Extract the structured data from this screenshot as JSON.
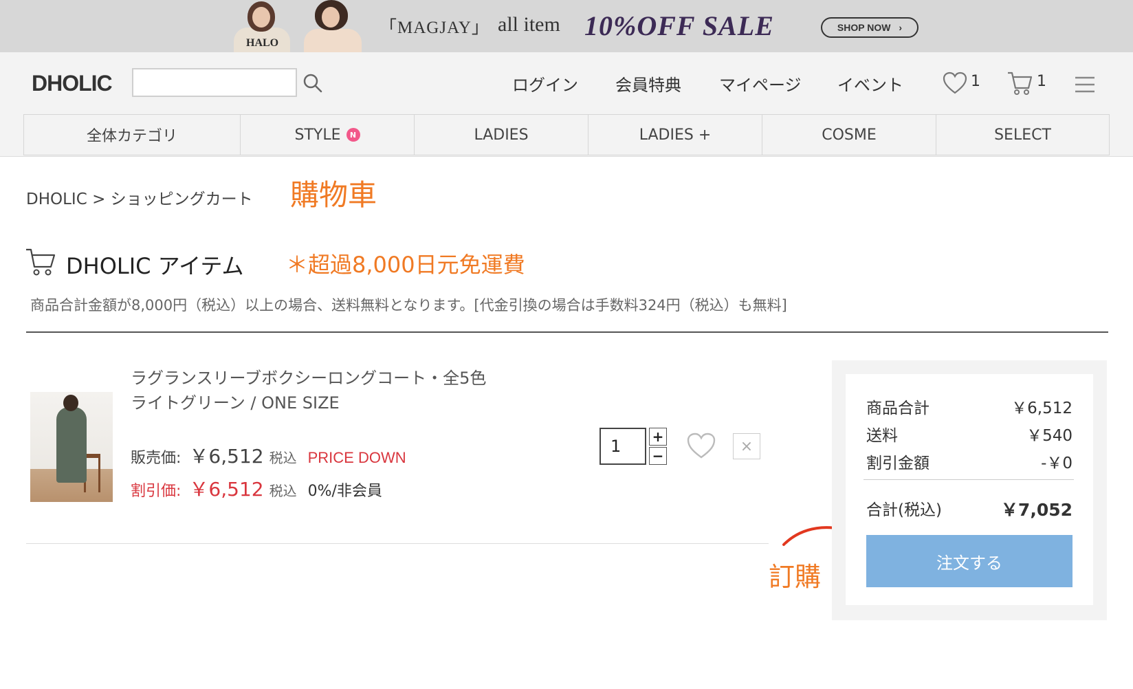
{
  "banner": {
    "sweater_text": "HALO",
    "bracket_text": "「MAGJAY」",
    "all_item": "all item",
    "sale_text": "10%OFF SALE",
    "shop_now": "SHOP NOW",
    "shop_now_arrow": "›"
  },
  "header": {
    "logo": "DHOLIC",
    "search_value": "",
    "nav": [
      "ログイン",
      "会員特典",
      "マイページ",
      "イベント"
    ],
    "wishlist_count": "1",
    "cart_count": "1"
  },
  "categories": [
    {
      "label": "全体カテゴリ"
    },
    {
      "label": "STYLE",
      "badge": "N"
    },
    {
      "label": "LADIES"
    },
    {
      "label": "LADIES +"
    },
    {
      "label": "COSME"
    },
    {
      "label": "SELECT"
    }
  ],
  "breadcrumb": "DHOLIC > ショッピングカート",
  "annotations": {
    "cart": "購物車",
    "shipping": "＊超過8,000日元免運費",
    "order": "訂購"
  },
  "section": {
    "title": "DHOLIC アイテム",
    "notice": "商品合計金額が8,000円（税込）以上の場合、送料無料となります。[代金引換の場合は手数料324円（税込）も無料]"
  },
  "item": {
    "name": "ラグランスリーブボクシーロングコート・全5色",
    "option": "ライトグリーン / ONE SIZE",
    "sale_label": "販売価:",
    "sale_price": "￥6,512",
    "tax_label": "税込",
    "price_down": "PRICE DOWN",
    "discount_label": "割引価:",
    "discount_price": "￥6,512",
    "member_rate": "0%/非会員",
    "quantity": "1",
    "plus": "+",
    "minus": "−",
    "remove": "×"
  },
  "summary": {
    "rows": [
      {
        "label": "商品合計",
        "value": "￥6,512"
      },
      {
        "label": "送料",
        "value": "￥540"
      },
      {
        "label": "割引金額",
        "value": "-￥0"
      }
    ],
    "total_label": "合計(税込)",
    "total_value": "￥7,052",
    "order_button": "注文する"
  },
  "colors": {
    "accent_orange": "#f07a24",
    "price_red": "#d9363e",
    "order_blue": "#7fb2e0",
    "badge_pink": "#f2588a"
  }
}
